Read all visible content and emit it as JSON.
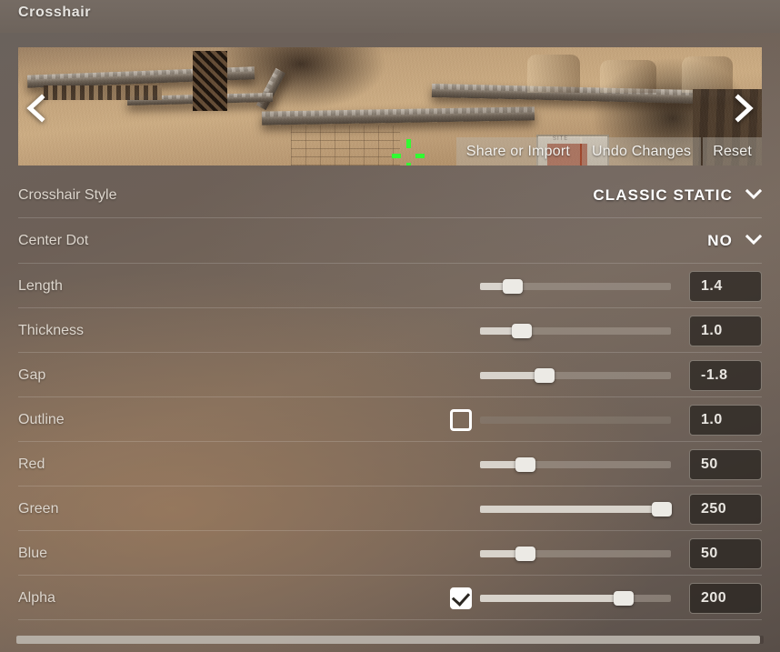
{
  "header": {
    "title": "Crosshair"
  },
  "preview": {
    "prev_arrow_icon": "chevron-left-icon",
    "next_arrow_icon": "chevron-right-icon",
    "crate_label": "SITE",
    "crosshair_color": "#32fa32",
    "actions": [
      {
        "label": "Share or Import",
        "name": "share-or-import-button"
      },
      {
        "label": "Undo Changes",
        "name": "undo-changes-button"
      },
      {
        "label": "Reset",
        "name": "reset-button"
      }
    ]
  },
  "settings": {
    "dropdowns": [
      {
        "label": "Crosshair Style",
        "value": "CLASSIC STATIC",
        "name": "crosshair-style",
        "chevron_icon": "chevron-down-icon"
      },
      {
        "label": "Center Dot",
        "value": "NO",
        "name": "center-dot",
        "chevron_icon": "chevron-down-icon"
      }
    ],
    "sliders": [
      {
        "label": "Length",
        "value": "1.4",
        "name": "length",
        "fill_percent": 17,
        "has_checkbox": false,
        "checked": false,
        "disabled": false
      },
      {
        "label": "Thickness",
        "value": "1.0",
        "name": "thickness",
        "fill_percent": 22,
        "has_checkbox": false,
        "checked": false,
        "disabled": false
      },
      {
        "label": "Gap",
        "value": "-1.8",
        "name": "gap",
        "fill_percent": 34,
        "has_checkbox": false,
        "checked": false,
        "disabled": false
      },
      {
        "label": "Outline",
        "value": "1.0",
        "name": "outline",
        "fill_percent": 0,
        "has_checkbox": true,
        "checked": false,
        "disabled": true
      },
      {
        "label": "Red",
        "value": "50",
        "name": "red",
        "fill_percent": 24,
        "has_checkbox": false,
        "checked": false,
        "disabled": false
      },
      {
        "label": "Green",
        "value": "250",
        "name": "green",
        "fill_percent": 95,
        "has_checkbox": false,
        "checked": false,
        "disabled": false
      },
      {
        "label": "Blue",
        "value": "50",
        "name": "blue",
        "fill_percent": 24,
        "has_checkbox": false,
        "checked": false,
        "disabled": false
      },
      {
        "label": "Alpha",
        "value": "200",
        "name": "alpha",
        "fill_percent": 75,
        "has_checkbox": true,
        "checked": true,
        "disabled": false
      }
    ]
  }
}
